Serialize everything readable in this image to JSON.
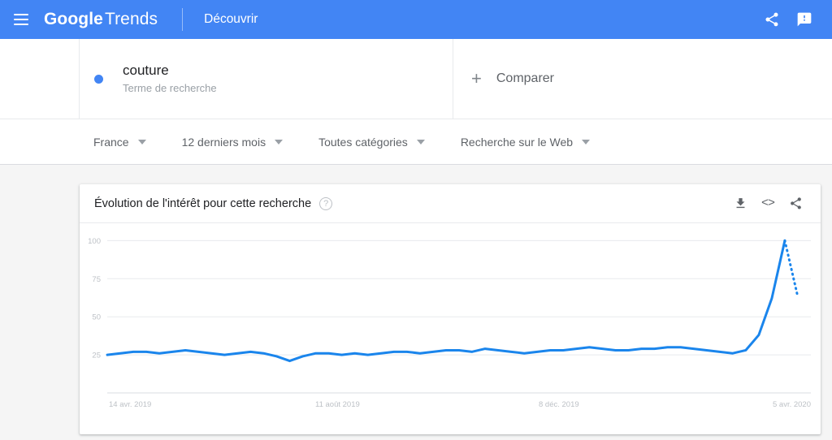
{
  "header": {
    "menu_icon": "hamburger-menu-icon",
    "brand_google": "Google",
    "brand_trends": "Trends",
    "discover_label": "Découvrir",
    "share_icon": "share-icon",
    "feedback_icon": "feedback-icon",
    "background_color": "#4285f4"
  },
  "search_term": {
    "dot_color": "#4285f4",
    "title": "couture",
    "subtitle": "Terme de recherche"
  },
  "compare": {
    "plus": "+",
    "label": "Comparer"
  },
  "filters": [
    {
      "label": "France",
      "name": "filter-location"
    },
    {
      "label": "12 derniers mois",
      "name": "filter-time-range"
    },
    {
      "label": "Toutes catégories",
      "name": "filter-category"
    },
    {
      "label": "Recherche sur le Web",
      "name": "filter-search-type"
    }
  ],
  "chart_card": {
    "title": "Évolution de l'intérêt pour cette recherche",
    "help_icon": "help-circle-icon",
    "help_glyph": "?",
    "actions": [
      {
        "name": "download-csv-button",
        "icon": "download-icon"
      },
      {
        "name": "embed-code-button",
        "icon": "embed-code-icon",
        "glyph": "<>"
      },
      {
        "name": "share-chart-button",
        "icon": "share-icon"
      }
    ]
  },
  "chart_data": {
    "type": "line",
    "title": "Évolution de l'intérêt pour cette recherche",
    "xlabel": "",
    "ylabel": "",
    "ylim": [
      0,
      105
    ],
    "yticks": [
      25,
      50,
      75,
      100
    ],
    "ytick_labels": [
      "25",
      "50",
      "75",
      "100"
    ],
    "xticks": [
      "14 avr. 2019",
      "11 août 2019",
      "8 déc. 2019",
      "5 avr. 2020"
    ],
    "grid": true,
    "legend": false,
    "line_color": "#1a85ec",
    "series_name": "couture",
    "partial_data_note": "dotted segment = partial data",
    "x": [
      0,
      1,
      2,
      3,
      4,
      5,
      6,
      7,
      8,
      9,
      10,
      11,
      12,
      13,
      14,
      15,
      16,
      17,
      18,
      19,
      20,
      21,
      22,
      23,
      24,
      25,
      26,
      27,
      28,
      29,
      30,
      31,
      32,
      33,
      34,
      35,
      36,
      37,
      38,
      39,
      40,
      41,
      42,
      43,
      44,
      45,
      46,
      47,
      48,
      49,
      50,
      51,
      52
    ],
    "values": [
      25,
      26,
      27,
      27,
      26,
      27,
      28,
      27,
      26,
      25,
      26,
      27,
      26,
      24,
      21,
      24,
      26,
      26,
      25,
      26,
      25,
      26,
      27,
      27,
      26,
      27,
      28,
      28,
      27,
      29,
      28,
      27,
      26,
      27,
      28,
      28,
      29,
      30,
      29,
      28,
      28,
      29,
      29,
      30,
      30,
      29,
      28,
      27,
      26,
      28,
      38,
      62,
      100
    ],
    "partial_values": [
      100,
      63
    ]
  }
}
